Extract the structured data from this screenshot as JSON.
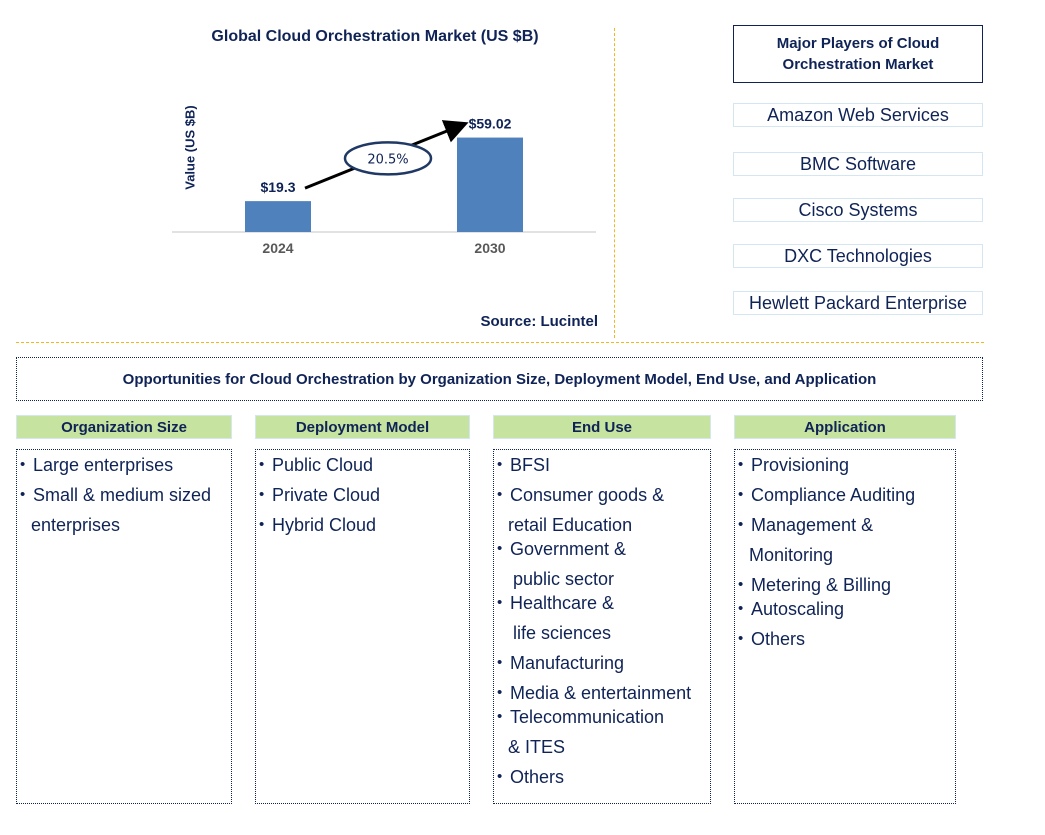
{
  "chart_data": {
    "type": "bar",
    "title": "Global Cloud Orchestration Market (US $B)",
    "xlabel": "",
    "ylabel": "Value (US $B)",
    "categories": [
      "2024",
      "2030"
    ],
    "values": [
      19.3,
      59.02
    ],
    "data_labels": [
      "$19.3",
      "$59.02"
    ],
    "ylim": [
      0,
      70
    ],
    "grid": false,
    "bar_color": "#4f81bd",
    "annotation": {
      "type": "cagr-arrow",
      "label": "20.5%",
      "from": "2024",
      "to": "2030"
    },
    "source": "Source: Lucintel"
  },
  "players": {
    "title": "Major Players of Cloud Orchestration Market",
    "items": [
      "Amazon Web Services",
      "BMC Software",
      "Cisco Systems",
      "DXC Technologies",
      "Hewlett Packard Enterprise"
    ]
  },
  "opportunities": {
    "title": "Opportunities for Cloud Orchestration by Organization Size, Deployment Model, End Use, and Application",
    "categories": [
      {
        "heading": "Organization Size",
        "items": [
          [
            "Large enterprises"
          ],
          [
            "Small & medium sized",
            "enterprises"
          ]
        ]
      },
      {
        "heading": "Deployment Model",
        "items": [
          [
            "Public Cloud"
          ],
          [
            "Private Cloud"
          ],
          [
            "Hybrid Cloud"
          ]
        ]
      },
      {
        "heading": "End Use",
        "items": [
          [
            "BFSI"
          ],
          [
            "Consumer goods &",
            "retail Education"
          ],
          [
            "Government &",
            "public sector"
          ],
          [
            "Healthcare &",
            "life sciences"
          ],
          [
            "Manufacturing"
          ],
          [
            "Media & entertainment"
          ],
          [
            "Telecommunication",
            "& ITES"
          ],
          [
            "Others"
          ]
        ]
      },
      {
        "heading": "Application",
        "items": [
          [
            "Provisioning"
          ],
          [
            "Compliance Auditing"
          ],
          [
            "Management &",
            "Monitoring"
          ],
          [
            "Metering & Billing"
          ],
          [
            "Autoscaling"
          ],
          [
            "Others"
          ]
        ]
      }
    ]
  },
  "colors": {
    "text": "#0f2356",
    "bar": "#4f81bd",
    "header_fill": "#c6e3a0",
    "divider": "#f2b71e"
  }
}
